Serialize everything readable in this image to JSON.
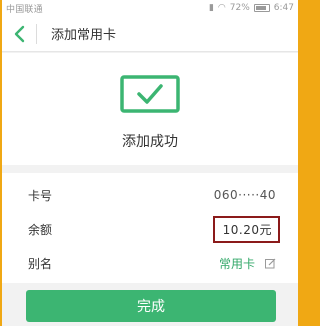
{
  "status_bar": {
    "carrier": "中国联通",
    "battery": "72%",
    "time": "6:47"
  },
  "header": {
    "title": "添加常用卡"
  },
  "success": {
    "message": "添加成功",
    "icon": "check-card-icon"
  },
  "info": {
    "card_number_label": "卡号",
    "card_number_value": "060·····40",
    "balance_label": "余额",
    "balance_value": "10.20元",
    "alias_label": "别名",
    "alias_value": "常用卡"
  },
  "actions": {
    "done_label": "完成"
  },
  "colors": {
    "accent": "#3cb572",
    "highlight_border": "#8b1a1a",
    "outer_border": "#f0a814"
  }
}
